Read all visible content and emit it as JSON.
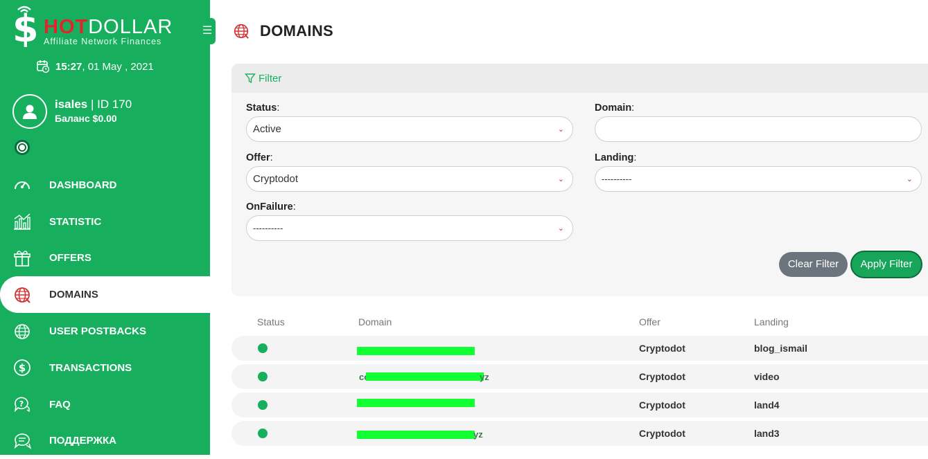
{
  "brand": {
    "hot": "HOT",
    "dollar": "DOLLAR",
    "tagline": "Affiliate Network Finances",
    "dollar_glyph": "$"
  },
  "sidebar_toggle_glyph": "☰",
  "datetime": {
    "time": "15:27",
    "date": ", 01 May , 2021"
  },
  "user": {
    "name": "isales",
    "id_text": " | ID 170",
    "balance": "Баланс $0.00"
  },
  "nav": [
    {
      "label": "DASHBOARD",
      "icon": "speedometer-icon",
      "active": false
    },
    {
      "label": "STATISTIC",
      "icon": "bar-chart-icon",
      "active": false
    },
    {
      "label": "OFFERS",
      "icon": "gift-icon",
      "active": false
    },
    {
      "label": "DOMAINS",
      "icon": "globe-icon",
      "active": true
    },
    {
      "label": "USER POSTBACKS",
      "icon": "network-globe-icon",
      "active": false
    },
    {
      "label": "TRANSACTIONS",
      "icon": "dollar-circle-icon",
      "active": false
    },
    {
      "label": "FAQ",
      "icon": "question-chat-icon",
      "active": false
    },
    {
      "label": "ПОДДЕРЖКА",
      "icon": "chat-icon",
      "active": false
    }
  ],
  "page": {
    "title": "DOMAINS"
  },
  "filter": {
    "heading": "Filter",
    "status_label": "Status",
    "status_value": "Active",
    "domain_label": "Domain",
    "domain_value": "",
    "offer_label": "Offer",
    "offer_value": "Cryptodot",
    "landing_label": "Landing",
    "landing_value": "----------",
    "onfailure_label": "OnFailure",
    "onfailure_value": "----------",
    "colon": ":",
    "clear_label": "Clear Filter",
    "apply_label": "Apply Filter"
  },
  "table": {
    "headers": {
      "status": "Status",
      "domain": "Domain",
      "offer": "Offer",
      "landing": "Landing"
    },
    "rows": [
      {
        "domain": "",
        "offer": "Cryptodot",
        "landing": "blog_ismail"
      },
      {
        "domain": "",
        "domain_prefix": "co",
        "domain_suffix": "yz",
        "offer": "Cryptodot",
        "landing": "video"
      },
      {
        "domain": "",
        "offer": "Cryptodot",
        "landing": "land4"
      },
      {
        "domain": "",
        "domain_suffix": "yz",
        "offer": "Cryptodot",
        "landing": "land3"
      }
    ]
  },
  "colors": {
    "brand_green": "#17ae5e",
    "brand_red": "#e0262c",
    "redaction": "#12ff34"
  }
}
